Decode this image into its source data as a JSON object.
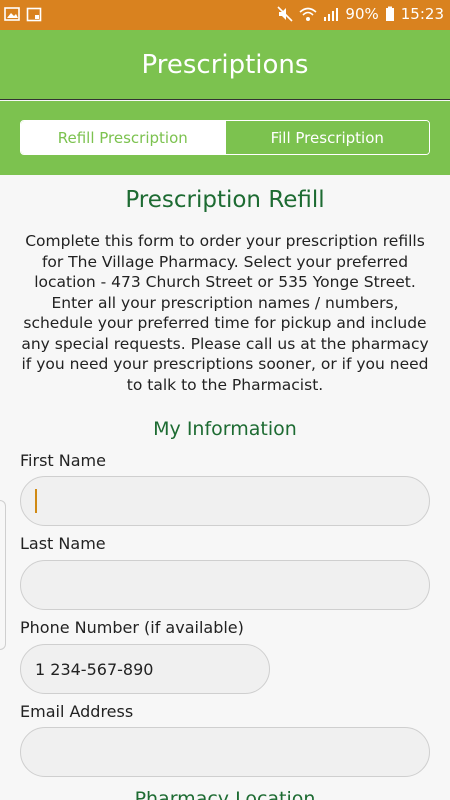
{
  "status_bar": {
    "left_icons": [
      "image-icon",
      "calendar-icon"
    ],
    "battery_percent": "90%",
    "time": "15:23"
  },
  "app_bar": {
    "title": "Prescriptions"
  },
  "tabs": [
    {
      "label": "Refill Prescription",
      "selected": true
    },
    {
      "label": "Fill Prescription",
      "selected": false
    }
  ],
  "form": {
    "heading": "Prescription Refill",
    "intro": "Complete this form to order your prescription refills for The Village Pharmacy. Select your preferred location - 473 Church Street or 535 Yonge Street. Enter all your prescription names / numbers, schedule your preferred time for pickup and include any special requests. Please call us at the pharmacy if you need your prescriptions sooner, or if you need to talk to the Pharmacist.",
    "my_info_heading": "My Information",
    "first_name": {
      "label": "First Name",
      "value": ""
    },
    "last_name": {
      "label": "Last Name",
      "value": ""
    },
    "phone": {
      "label": "Phone Number (if available)",
      "value": "1 234-567-890"
    },
    "email": {
      "label": "Email Address",
      "value": ""
    },
    "next_section_heading": "Pharmacy Location"
  },
  "colors": {
    "status_bar": "#d9821f",
    "app_bar": "#7cc24f",
    "heading_green": "#1d6b32"
  }
}
